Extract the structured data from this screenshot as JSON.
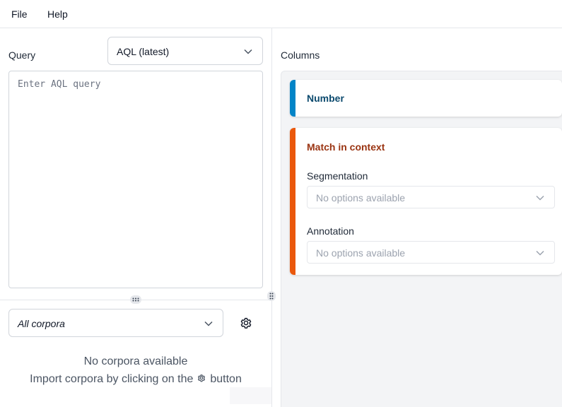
{
  "menubar": {
    "file": "File",
    "help": "Help"
  },
  "query": {
    "label": "Query",
    "language": "AQL (latest)",
    "placeholder": "Enter AQL query"
  },
  "corpora": {
    "selected": "All corpora",
    "empty_title": "No corpora available",
    "empty_hint_prefix": "Import corpora by clicking on the",
    "empty_hint_suffix": "button"
  },
  "columns": {
    "label": "Columns",
    "cards": [
      {
        "title": "Number",
        "color": "#0284c7"
      },
      {
        "title": "Match in context",
        "color": "#ea580c",
        "fields": [
          {
            "label": "Segmentation",
            "value": "No options available"
          },
          {
            "label": "Annotation",
            "value": "No options available"
          }
        ]
      }
    ]
  }
}
